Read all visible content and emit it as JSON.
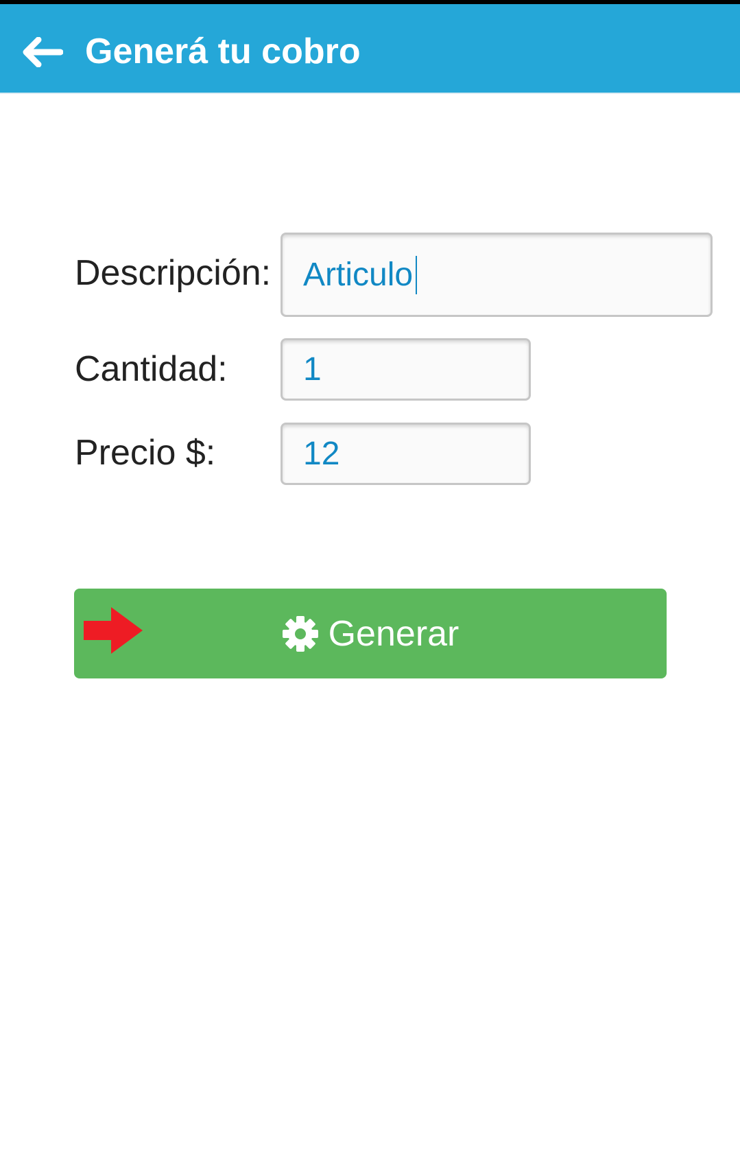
{
  "colors": {
    "appbar": "#25a7d8",
    "button": "#5cb85c",
    "input_text": "#1188c4",
    "arrow": "#ee1c24"
  },
  "header": {
    "back_icon": "arrow-left-icon",
    "title": "Generá tu cobro"
  },
  "form": {
    "description": {
      "label": "Descripción:",
      "value": "Articulo"
    },
    "quantity": {
      "label": "Cantidad:",
      "value": "1"
    },
    "price": {
      "label": "Precio $:",
      "value": "12"
    }
  },
  "generate": {
    "label": "Generar",
    "icon": "gear-icon",
    "pointer_icon": "red-arrow-right-icon"
  }
}
